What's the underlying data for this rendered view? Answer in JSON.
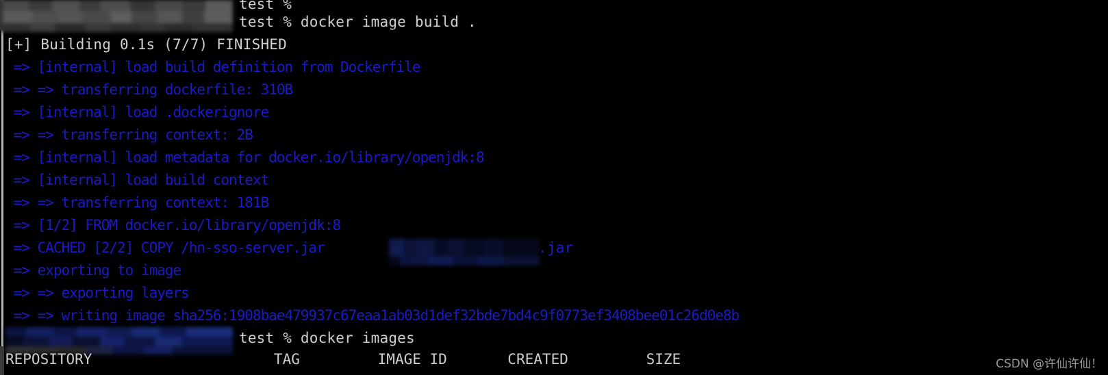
{
  "terminal": {
    "background_color": "#000000",
    "output_color": "#1a1ac8",
    "prompt_color": "#cfcfcf",
    "prompt_line_1": "test %",
    "prompt_line_2": "test % docker image build .",
    "build_status": "[+] Building 0.1s (7/7) FINISHED",
    "build_steps": [
      " => [internal] load build definition from Dockerfile",
      " => => transferring dockerfile: 310B",
      " => [internal] load .dockerignore",
      " => => transferring context: 2B",
      " => [internal] load metadata for docker.io/library/openjdk:8",
      " => [internal] load build context",
      " => => transferring context: 181B",
      " => [1/2] FROM docker.io/library/openjdk:8",
      " => CACHED [2/2] COPY /hn-sso-server.jar",
      " => exporting to image",
      " => => exporting layers",
      " => => writing image sha256:1908bae479937c67eaa1ab03d1def32bde7bd4c9f0773ef3408bee01c26d0e8b"
    ],
    "cached_line_prefix": " => CACHED [2/2] COPY /hn-sso-server.jar ",
    "cached_line_suffix": ".jar",
    "prompt_line_3": "test % docker images",
    "image_hash": "sha256:1908bae479937c67eaa1ab03d1def32bde7bd4c9f0773ef3408bee01c26d0e8b"
  },
  "images_table": {
    "headers": [
      "REPOSITORY",
      "TAG",
      "IMAGE ID",
      "CREATED",
      "SIZE"
    ],
    "header_row": "REPOSITORY                     TAG         IMAGE ID       CREATED         SIZE"
  },
  "redactions": {
    "hostname_top": "",
    "jar_path_middle": "",
    "hostname_bottom": ""
  },
  "watermark": {
    "text": "CSDN @许仙许仙！"
  }
}
